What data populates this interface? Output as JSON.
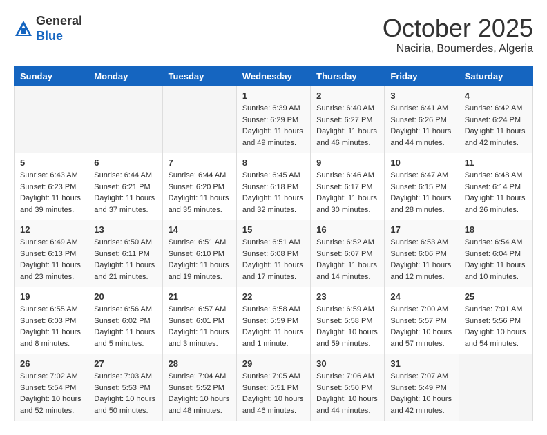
{
  "header": {
    "logo_line1": "General",
    "logo_line2": "Blue",
    "month": "October 2025",
    "location": "Naciria, Boumerdes, Algeria"
  },
  "days_of_week": [
    "Sunday",
    "Monday",
    "Tuesday",
    "Wednesday",
    "Thursday",
    "Friday",
    "Saturday"
  ],
  "weeks": [
    [
      {
        "day": "",
        "info": ""
      },
      {
        "day": "",
        "info": ""
      },
      {
        "day": "",
        "info": ""
      },
      {
        "day": "1",
        "info": "Sunrise: 6:39 AM\nSunset: 6:29 PM\nDaylight: 11 hours and 49 minutes."
      },
      {
        "day": "2",
        "info": "Sunrise: 6:40 AM\nSunset: 6:27 PM\nDaylight: 11 hours and 46 minutes."
      },
      {
        "day": "3",
        "info": "Sunrise: 6:41 AM\nSunset: 6:26 PM\nDaylight: 11 hours and 44 minutes."
      },
      {
        "day": "4",
        "info": "Sunrise: 6:42 AM\nSunset: 6:24 PM\nDaylight: 11 hours and 42 minutes."
      }
    ],
    [
      {
        "day": "5",
        "info": "Sunrise: 6:43 AM\nSunset: 6:23 PM\nDaylight: 11 hours and 39 minutes."
      },
      {
        "day": "6",
        "info": "Sunrise: 6:44 AM\nSunset: 6:21 PM\nDaylight: 11 hours and 37 minutes."
      },
      {
        "day": "7",
        "info": "Sunrise: 6:44 AM\nSunset: 6:20 PM\nDaylight: 11 hours and 35 minutes."
      },
      {
        "day": "8",
        "info": "Sunrise: 6:45 AM\nSunset: 6:18 PM\nDaylight: 11 hours and 32 minutes."
      },
      {
        "day": "9",
        "info": "Sunrise: 6:46 AM\nSunset: 6:17 PM\nDaylight: 11 hours and 30 minutes."
      },
      {
        "day": "10",
        "info": "Sunrise: 6:47 AM\nSunset: 6:15 PM\nDaylight: 11 hours and 28 minutes."
      },
      {
        "day": "11",
        "info": "Sunrise: 6:48 AM\nSunset: 6:14 PM\nDaylight: 11 hours and 26 minutes."
      }
    ],
    [
      {
        "day": "12",
        "info": "Sunrise: 6:49 AM\nSunset: 6:13 PM\nDaylight: 11 hours and 23 minutes."
      },
      {
        "day": "13",
        "info": "Sunrise: 6:50 AM\nSunset: 6:11 PM\nDaylight: 11 hours and 21 minutes."
      },
      {
        "day": "14",
        "info": "Sunrise: 6:51 AM\nSunset: 6:10 PM\nDaylight: 11 hours and 19 minutes."
      },
      {
        "day": "15",
        "info": "Sunrise: 6:51 AM\nSunset: 6:08 PM\nDaylight: 11 hours and 17 minutes."
      },
      {
        "day": "16",
        "info": "Sunrise: 6:52 AM\nSunset: 6:07 PM\nDaylight: 11 hours and 14 minutes."
      },
      {
        "day": "17",
        "info": "Sunrise: 6:53 AM\nSunset: 6:06 PM\nDaylight: 11 hours and 12 minutes."
      },
      {
        "day": "18",
        "info": "Sunrise: 6:54 AM\nSunset: 6:04 PM\nDaylight: 11 hours and 10 minutes."
      }
    ],
    [
      {
        "day": "19",
        "info": "Sunrise: 6:55 AM\nSunset: 6:03 PM\nDaylight: 11 hours and 8 minutes."
      },
      {
        "day": "20",
        "info": "Sunrise: 6:56 AM\nSunset: 6:02 PM\nDaylight: 11 hours and 5 minutes."
      },
      {
        "day": "21",
        "info": "Sunrise: 6:57 AM\nSunset: 6:01 PM\nDaylight: 11 hours and 3 minutes."
      },
      {
        "day": "22",
        "info": "Sunrise: 6:58 AM\nSunset: 5:59 PM\nDaylight: 11 hours and 1 minute."
      },
      {
        "day": "23",
        "info": "Sunrise: 6:59 AM\nSunset: 5:58 PM\nDaylight: 10 hours and 59 minutes."
      },
      {
        "day": "24",
        "info": "Sunrise: 7:00 AM\nSunset: 5:57 PM\nDaylight: 10 hours and 57 minutes."
      },
      {
        "day": "25",
        "info": "Sunrise: 7:01 AM\nSunset: 5:56 PM\nDaylight: 10 hours and 54 minutes."
      }
    ],
    [
      {
        "day": "26",
        "info": "Sunrise: 7:02 AM\nSunset: 5:54 PM\nDaylight: 10 hours and 52 minutes."
      },
      {
        "day": "27",
        "info": "Sunrise: 7:03 AM\nSunset: 5:53 PM\nDaylight: 10 hours and 50 minutes."
      },
      {
        "day": "28",
        "info": "Sunrise: 7:04 AM\nSunset: 5:52 PM\nDaylight: 10 hours and 48 minutes."
      },
      {
        "day": "29",
        "info": "Sunrise: 7:05 AM\nSunset: 5:51 PM\nDaylight: 10 hours and 46 minutes."
      },
      {
        "day": "30",
        "info": "Sunrise: 7:06 AM\nSunset: 5:50 PM\nDaylight: 10 hours and 44 minutes."
      },
      {
        "day": "31",
        "info": "Sunrise: 7:07 AM\nSunset: 5:49 PM\nDaylight: 10 hours and 42 minutes."
      },
      {
        "day": "",
        "info": ""
      }
    ]
  ]
}
